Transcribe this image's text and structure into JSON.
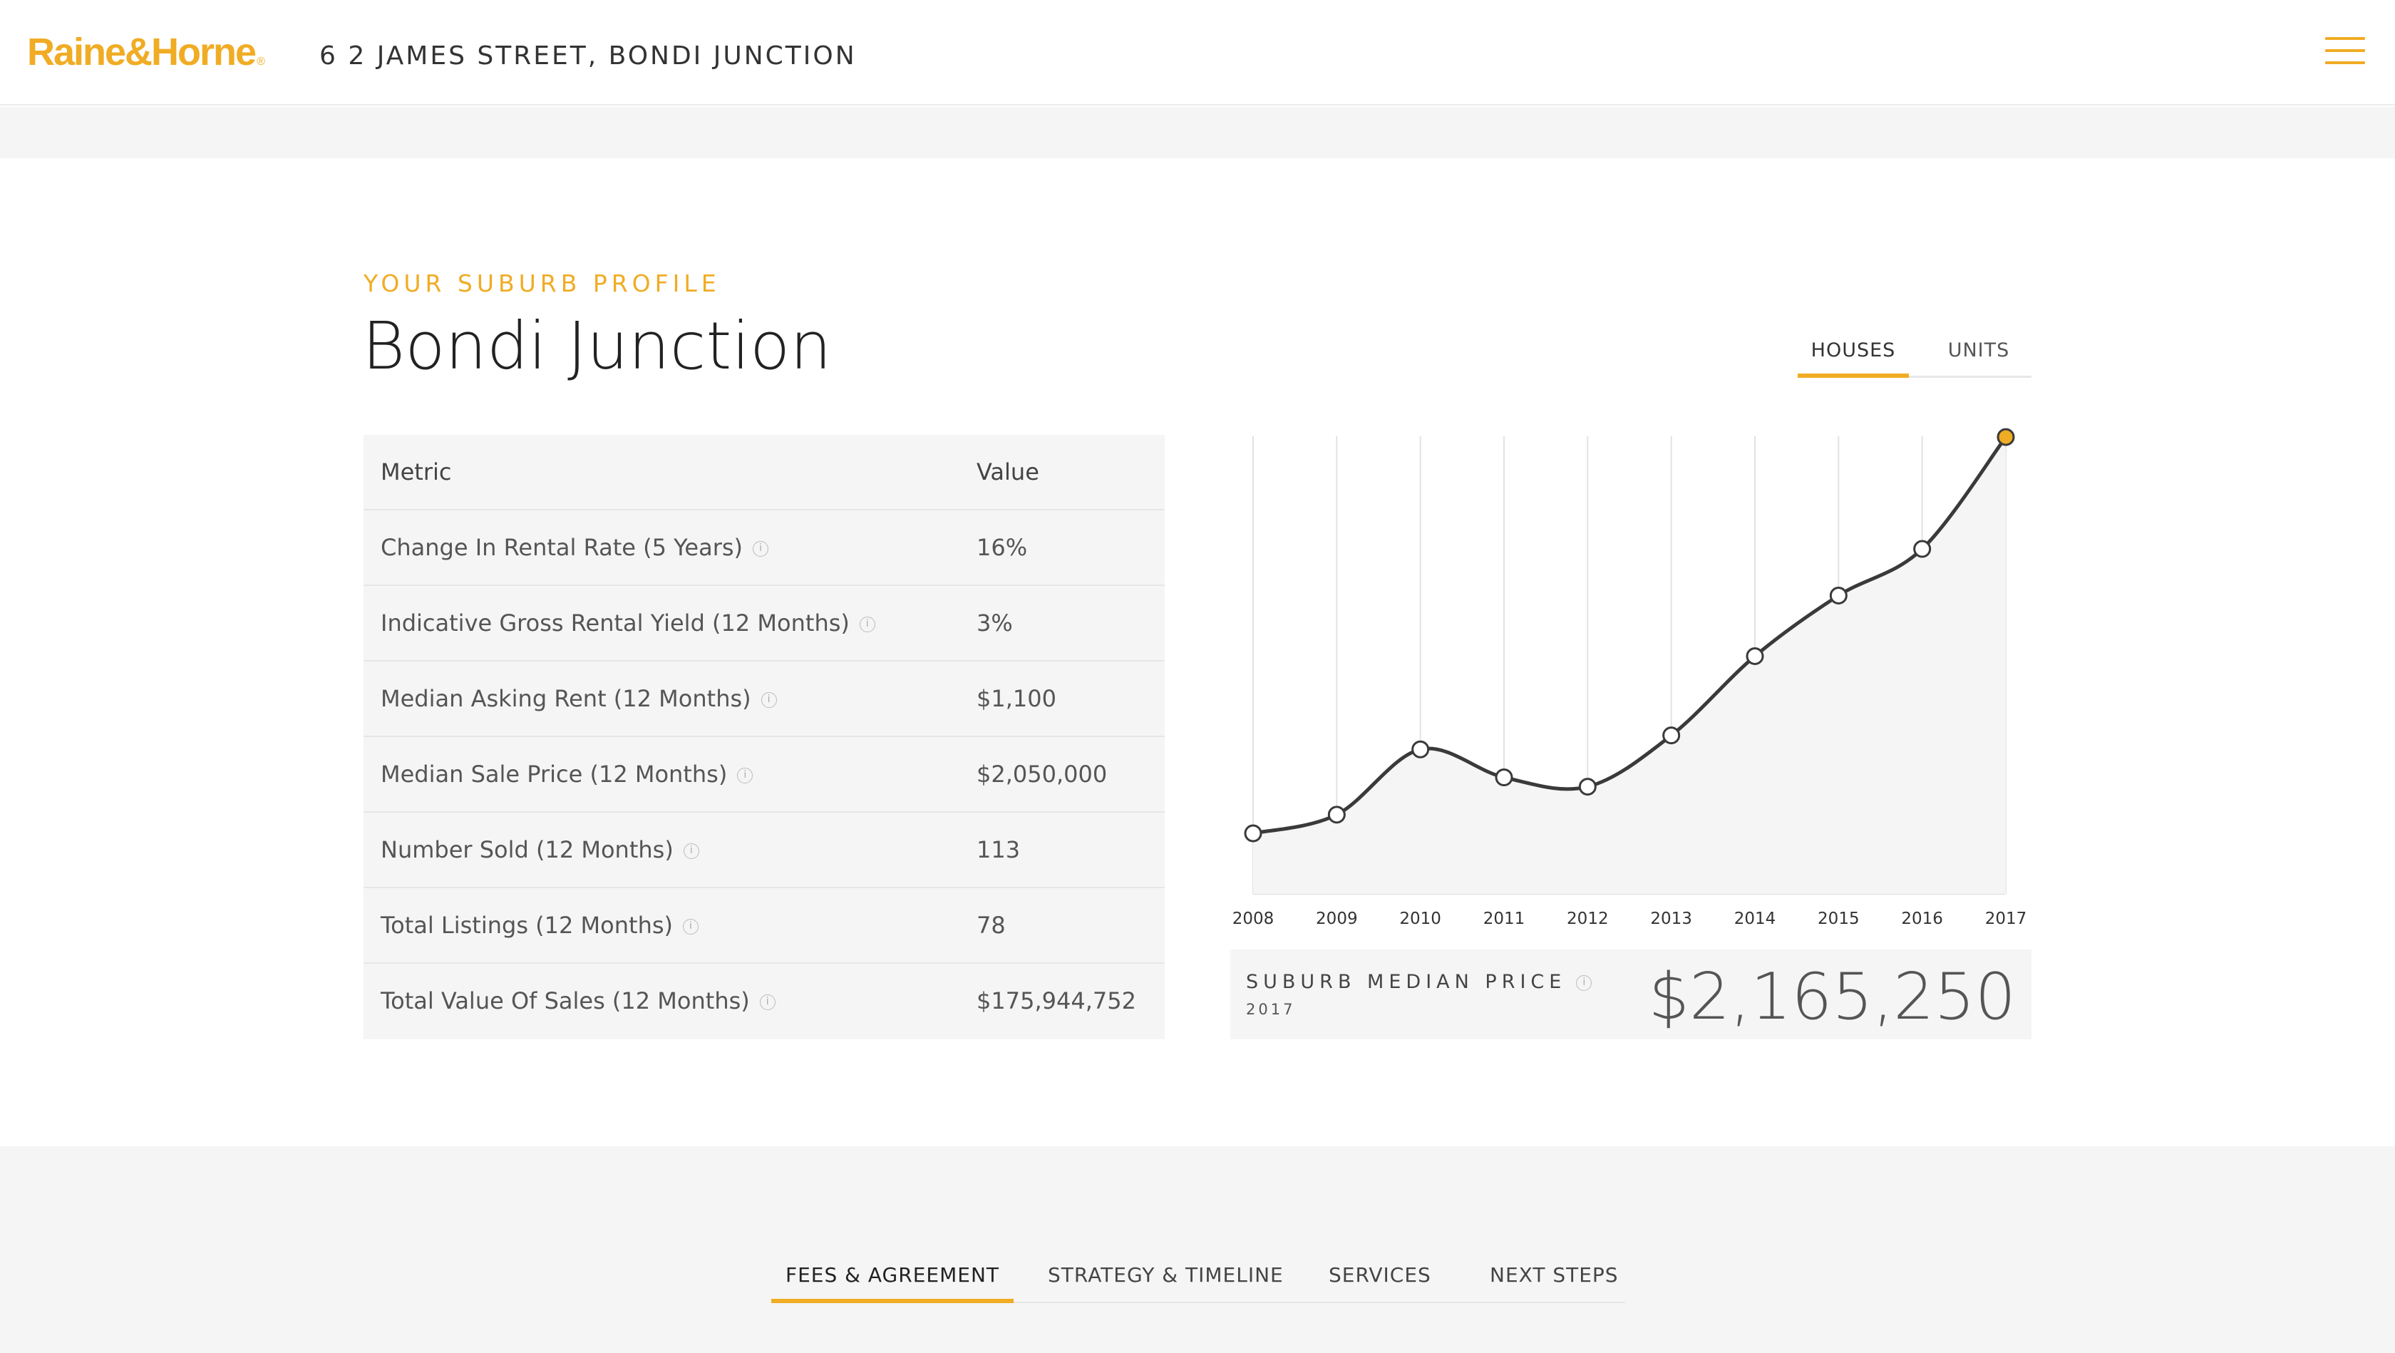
{
  "header": {
    "brand": "Raine&Horne",
    "brand_mark": "®",
    "address": "6 2 JAMES STREET, BONDI JUNCTION",
    "menu_icon": "hamburger-icon"
  },
  "profile": {
    "eyebrow": "YOUR SUBURB PROFILE",
    "title": "Bondi Junction",
    "property_tabs": [
      "HOUSES",
      "UNITS"
    ],
    "active_tab": "HOUSES"
  },
  "metrics_table": {
    "headers": [
      "Metric",
      "Value"
    ],
    "rows": [
      {
        "metric": "Change In Rental Rate (5 Years)",
        "value": "16%"
      },
      {
        "metric": "Indicative Gross Rental Yield (12 Months)",
        "value": "3%"
      },
      {
        "metric": "Median Asking Rent (12 Months)",
        "value": "$1,100"
      },
      {
        "metric": "Median Sale Price (12 Months)",
        "value": "$2,050,000"
      },
      {
        "metric": "Number Sold (12 Months)",
        "value": "113"
      },
      {
        "metric": "Total Listings (12 Months)",
        "value": "78"
      },
      {
        "metric": "Total Value Of Sales (12 Months)",
        "value": "$175,944,752"
      }
    ],
    "info_icon": "info-icon"
  },
  "chart_data": {
    "type": "line",
    "x": [
      "2008",
      "2009",
      "2010",
      "2011",
      "2012",
      "2013",
      "2014",
      "2015",
      "2016",
      "2017"
    ],
    "values": [
      0.13,
      0.17,
      0.31,
      0.25,
      0.23,
      0.34,
      0.51,
      0.64,
      0.74,
      0.98
    ],
    "value_scale": "relative (no y-axis printed)",
    "highlight_index": 9,
    "grid": "vertical",
    "area_fill": true
  },
  "median": {
    "label": "SUBURB MEDIAN PRICE",
    "year": "2017",
    "value": "$2,165,250"
  },
  "bottom_tabs": [
    "FEES & AGREEMENT",
    "STRATEGY & TIMELINE",
    "SERVICES",
    "NEXT STEPS"
  ],
  "colors": {
    "accent": "#f0ac24",
    "line": "#3a3a3a",
    "panel": "#f5f5f5"
  }
}
